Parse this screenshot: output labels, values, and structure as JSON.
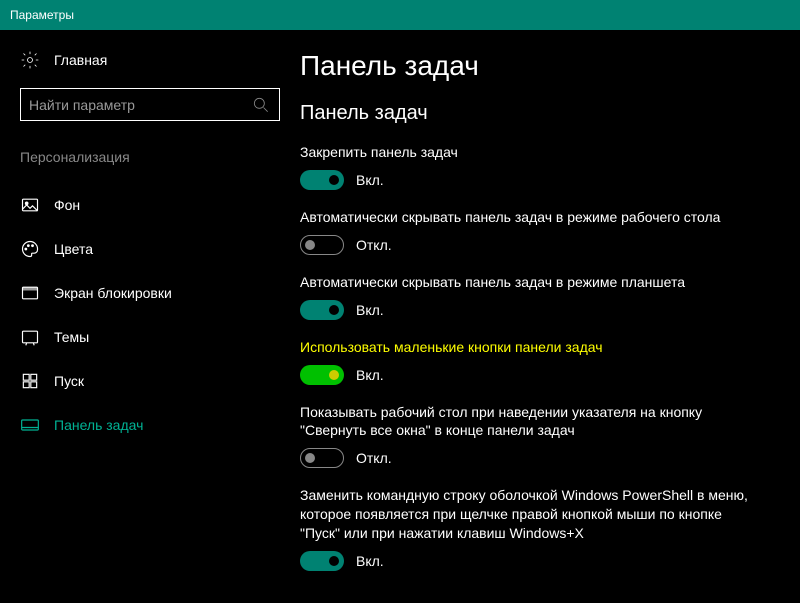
{
  "window": {
    "title": "Параметры"
  },
  "sidebar": {
    "home": "Главная",
    "search_placeholder": "Найти параметр",
    "category": "Персонализация",
    "items": [
      {
        "label": "Фон"
      },
      {
        "label": "Цвета"
      },
      {
        "label": "Экран блокировки"
      },
      {
        "label": "Темы"
      },
      {
        "label": "Пуск"
      },
      {
        "label": "Панель задач"
      }
    ]
  },
  "main": {
    "title": "Панель задач",
    "section": "Панель задач",
    "on_label": "Вкл.",
    "off_label": "Откл.",
    "settings": [
      {
        "label": "Закрепить панель задач",
        "on": true,
        "highlight": false
      },
      {
        "label": "Автоматически скрывать панель задач в режиме рабочего стола",
        "on": false,
        "highlight": false
      },
      {
        "label": "Автоматически скрывать панель задач в режиме планшета",
        "on": true,
        "highlight": false
      },
      {
        "label": "Использовать маленькие кнопки панели задач",
        "on": true,
        "highlight": true
      },
      {
        "label": "Показывать рабочий стол при наведении указателя на кнопку \"Свернуть все окна\" в конце панели задач",
        "on": false,
        "highlight": false
      },
      {
        "label": "Заменить командную строку оболочкой Windows PowerShell в меню, которое появляется при щелчке правой кнопкой мыши по кнопке \"Пуск\" или при нажатии клавиш Windows+X",
        "on": true,
        "highlight": false
      }
    ]
  }
}
